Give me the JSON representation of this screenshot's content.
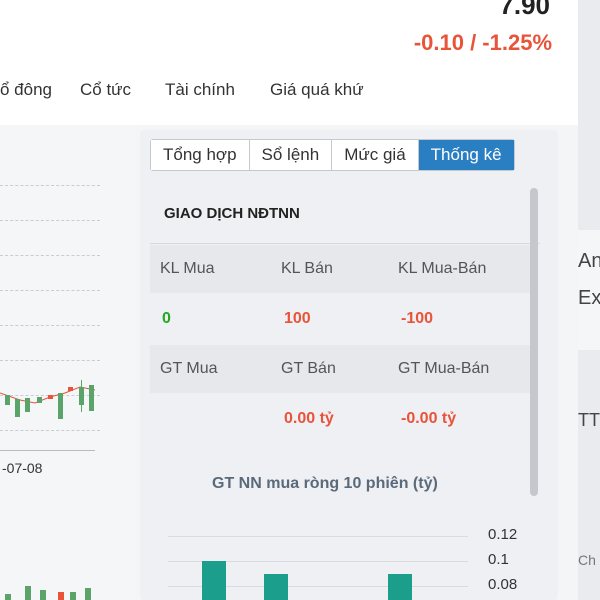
{
  "header": {
    "price": "7.90",
    "change": "-0.10 / -1.25%"
  },
  "nav": [
    {
      "label": "ổ đông"
    },
    {
      "label": "Cổ tức"
    },
    {
      "label": "Tài chính"
    },
    {
      "label": "Giá quá khứ"
    }
  ],
  "chart": {
    "date_label": "-07-08"
  },
  "tabs": [
    {
      "label": "Tổng hợp",
      "active": false
    },
    {
      "label": "Sổ lệnh",
      "active": false
    },
    {
      "label": "Mức giá",
      "active": false
    },
    {
      "label": "Thống kê",
      "active": true
    }
  ],
  "stats": {
    "title": "GIAO DỊCH NĐTNN",
    "row1_headers": [
      "KL Mua",
      "KL Bán",
      "KL Mua-Bán"
    ],
    "row1_values": [
      "0",
      "100",
      "-100"
    ],
    "row2_headers": [
      "GT Mua",
      "GT Bán",
      "GT Mua-Bán"
    ],
    "row2_values": [
      "",
      "0.00 tỷ",
      "-0.00 tỷ"
    ]
  },
  "gtnn": {
    "title": "GT NN mua ròng 10 phiên (tỷ)",
    "ticks": [
      "0.12",
      "0.1",
      "0.08"
    ],
    "bars": [
      0.1,
      0.09,
      0.09
    ]
  },
  "side": {
    "a": "An",
    "b": "Exc",
    "c": "TT",
    "d": "Ch"
  },
  "colors": {
    "accent": "#2a7ec2",
    "up": "#1faa1f",
    "down": "#e8533a",
    "bar": "#1c9e8c"
  }
}
